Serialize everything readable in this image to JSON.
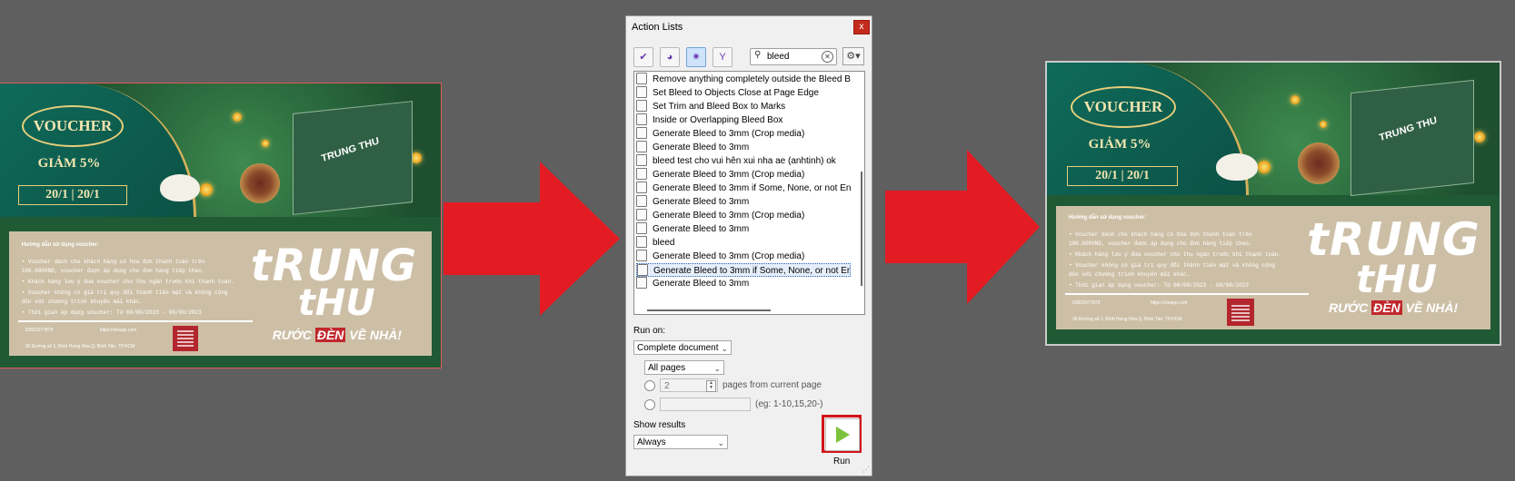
{
  "colors": {
    "background": "#5f5f5f",
    "arrow_red": "#e31b23",
    "voucher_green": "#1f5a35",
    "voucher_beige": "#cdbfa6",
    "gold": "#e8cf7a",
    "selection_outline": "#d4141a",
    "run_green": "#7cc13a"
  },
  "voucher": {
    "title": "VOUCHER",
    "discount": "GIẢM 5%",
    "date_left": "20/1",
    "date_sep": "|",
    "date_right": "20/1",
    "box_brand": "TRUNG THU",
    "guide_title": "Hướng dẫn sử dụng voucher:",
    "guide_lines": [
      "• Voucher dành cho khách hàng có hóa đơn thanh toán trên",
      "  100.000VND, voucher được áp dụng cho đơn hàng tiếp theo.",
      "• Khách hàng lưu ý đưa voucher cho thu ngân trước khi thanh toán.",
      "• Voucher không có giá trị quy đổi thành tiền mặt và không cộng",
      "  dồn với chương trình khuyến mãi khác.",
      "• Thời gian áp dụng voucher: Từ 00/00/2023 - 00/00/2023"
    ],
    "phone": "02822077879",
    "website": "https://vinaqo.com",
    "address": "36 Đường số 1, Bình Hưng Hòa Q. Bình Tân, TP.HCM",
    "big_word_1": "tRUNG",
    "big_word_2": "tHU",
    "tagline_prefix": "RƯỚC",
    "tagline_highlight": "ĐÈN",
    "tagline_suffix": "VỀ NHÀ!"
  },
  "dialog": {
    "title": "Action Lists",
    "close_label": "x",
    "toolbar": [
      {
        "name": "checkmark",
        "glyph": "✔"
      },
      {
        "name": "globe",
        "glyph": "◕"
      },
      {
        "name": "gear",
        "glyph": "✷"
      },
      {
        "name": "branch",
        "glyph": "Y"
      }
    ],
    "search": {
      "value": "bleed",
      "clear": "✕"
    },
    "gear_menu": "⚙▾",
    "actions": [
      "Remove anything completely outside the Bleed Box",
      "Set Bleed to Objects Close at Page Edge",
      "Set Trim and Bleed Box to Marks",
      "Inside or Overlapping Bleed Box",
      "Generate Bleed to 3mm (Crop media)",
      "Generate Bleed to 3mm",
      "bleed test cho vui hên xui nha ae (anhtinh) ok",
      "Generate Bleed to 3mm (Crop media)",
      "Generate Bleed to 3mm if Some, None, or not Enou",
      "Generate Bleed to 3mm",
      "Generate Bleed to 3mm (Crop media)",
      "Generate Bleed to 3mm",
      "bleed",
      "Generate Bleed to 3mm (Crop media)",
      "Generate Bleed to 3mm if Some, None, or not Enou",
      "Generate Bleed to 3mm"
    ],
    "selected_index": 14,
    "run_on_label": "Run on:",
    "run_on_value": "Complete document",
    "pages_value": "All pages",
    "pages_count": "2",
    "pages_from_label": "pages from current page",
    "range_hint": "(eg: 1-10,15,20-)",
    "show_results_label": "Show results",
    "show_results_value": "Always",
    "run_label": "Run"
  }
}
